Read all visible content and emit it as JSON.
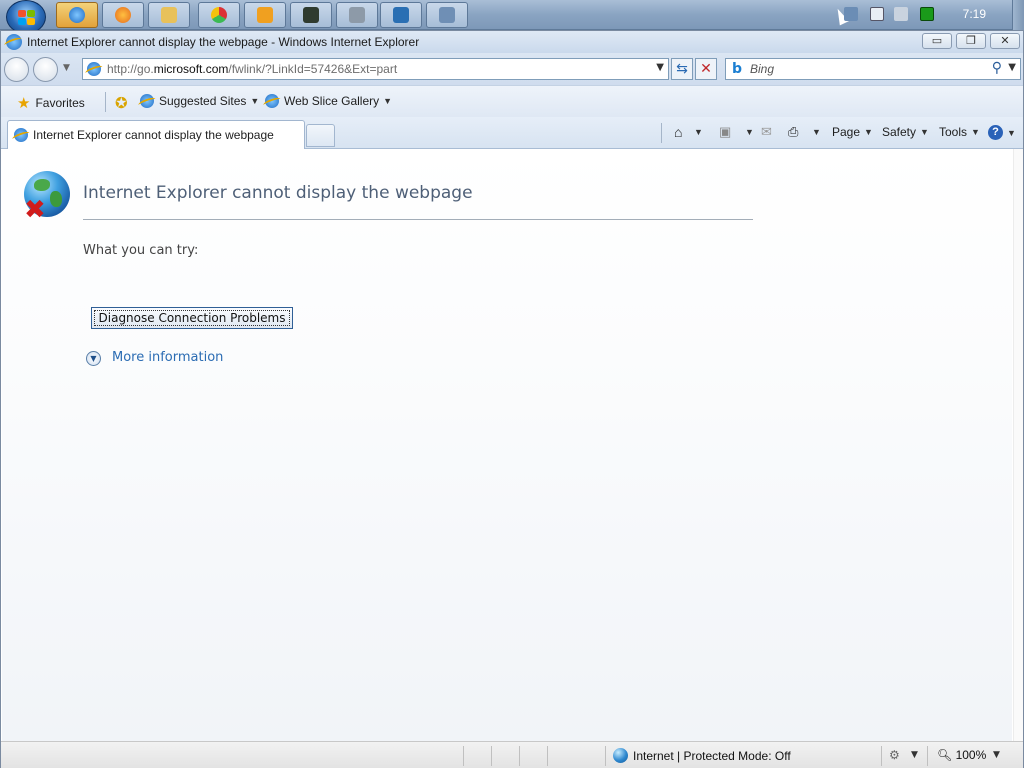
{
  "taskbar": {
    "clock": "7:19",
    "buttons": [
      {
        "name": "ie-taskbar-button",
        "color": "#1e6ac2",
        "active": true
      },
      {
        "name": "firefox-taskbar-button",
        "color": "#e56b1f"
      },
      {
        "name": "explorer-taskbar-button",
        "color": "#e8c15a"
      },
      {
        "name": "chrome-taskbar-button",
        "color": "#3a9b3a"
      },
      {
        "name": "media-taskbar-button",
        "color": "#f0a020"
      },
      {
        "name": "terminal-taskbar-button",
        "color": "#2f3b2f"
      },
      {
        "name": "window-taskbar-button",
        "color": "#8d9aa8"
      },
      {
        "name": "paint-taskbar-button",
        "color": "#2a6fb3"
      },
      {
        "name": "app-taskbar-button",
        "color": "#6f8fb5"
      }
    ]
  },
  "window": {
    "title": "Internet Explorer cannot display the webpage - Windows Internet Explorer",
    "minimize": "▭",
    "restore": "❐",
    "close": "✕"
  },
  "address": {
    "url_prefix": "http://go.",
    "url_domain": "microsoft.com",
    "url_rest": "/fwlink/?LinkId=57426&Ext=part"
  },
  "search": {
    "placeholder": "Bing",
    "engine_icon": "b"
  },
  "favorites_bar": {
    "favorites_label": "Favorites",
    "suggested_sites_label": "Suggested Sites",
    "web_slice_gallery_label": "Web Slice Gallery"
  },
  "tab": {
    "title": "Internet Explorer cannot display the webpage"
  },
  "command_bar": {
    "page_label": "Page",
    "safety_label": "Safety",
    "tools_label": "Tools"
  },
  "content": {
    "error_title": "Internet Explorer cannot display the webpage",
    "try_label": "What you can try:",
    "diagnose_button": "Diagnose Connection Problems",
    "more_info": "More information"
  },
  "status_bar": {
    "zone": "Internet | Protected Mode: Off",
    "zoom": "100%"
  },
  "colors": {
    "accent": "#2b6cb3",
    "error_x": "#d11b1b",
    "title_text": "#4e5f77"
  }
}
